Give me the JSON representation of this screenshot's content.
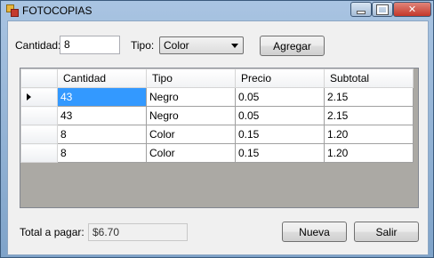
{
  "window": {
    "title": "FOTOCOPIAS"
  },
  "form": {
    "cantidad_label": "Cantidad:",
    "cantidad_value": "8",
    "tipo_label": "Tipo:",
    "tipo_value": "Color",
    "agregar_label": "Agregar"
  },
  "grid": {
    "columns": [
      "Cantidad",
      "Tipo",
      "Precio",
      "Subtotal"
    ],
    "rows": [
      [
        "43",
        "Negro",
        "0.05",
        "2.15"
      ],
      [
        "43",
        "Negro",
        "0.05",
        "2.15"
      ],
      [
        "8",
        "Color",
        "0.15",
        "1.20"
      ],
      [
        "8",
        "Color",
        "0.15",
        "1.20"
      ]
    ]
  },
  "footer": {
    "total_label": "Total a pagar:",
    "total_value": "$6.70",
    "nueva_label": "Nueva",
    "salir_label": "Salir"
  }
}
